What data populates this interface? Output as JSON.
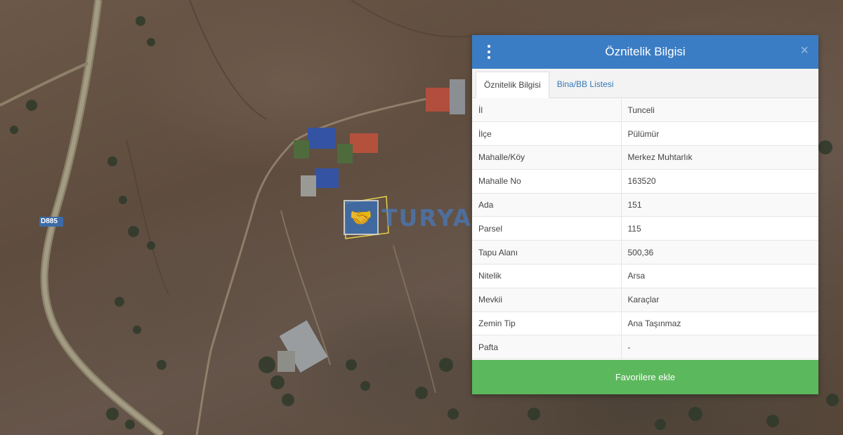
{
  "map": {
    "road_label": "D885",
    "watermark_text": "TURYAP"
  },
  "panel": {
    "title": "Öznitelik Bilgisi",
    "tabs": [
      {
        "label": "Öznitelik Bilgisi",
        "active": true
      },
      {
        "label": "Bina/BB Listesi",
        "active": false
      }
    ],
    "rows": [
      {
        "key": "İl",
        "value": "Tunceli"
      },
      {
        "key": "İlçe",
        "value": "Pülümür"
      },
      {
        "key": "Mahalle/Köy",
        "value": "Merkez Muhtarlık"
      },
      {
        "key": "Mahalle No",
        "value": "163520"
      },
      {
        "key": "Ada",
        "value": "151"
      },
      {
        "key": "Parsel",
        "value": "115"
      },
      {
        "key": "Tapu Alanı",
        "value": "500,36"
      },
      {
        "key": "Nitelik",
        "value": "Arsa"
      },
      {
        "key": "Mevkii",
        "value": "Karaçlar"
      },
      {
        "key": "Zemin Tip",
        "value": "Ana Taşınmaz"
      },
      {
        "key": "Pafta",
        "value": "-"
      }
    ],
    "favorite_button": "Favorilere ekle",
    "close_symbol": "×"
  },
  "colors": {
    "header": "#3b7dc4",
    "button": "#5cb85c",
    "link": "#3579b8"
  }
}
